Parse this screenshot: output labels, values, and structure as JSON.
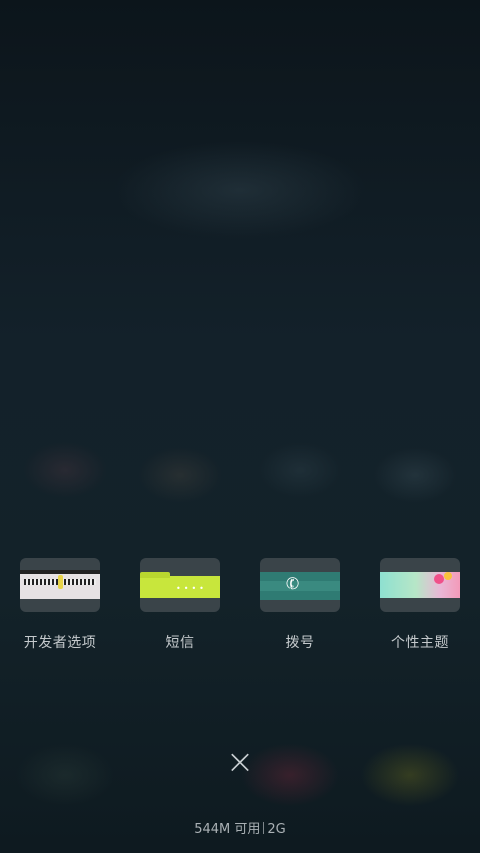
{
  "recent_apps": [
    {
      "label": "开发者选项",
      "thumb": "developer-options-preview"
    },
    {
      "label": "短信",
      "thumb": "sms-preview"
    },
    {
      "label": "拨号",
      "thumb": "dialer-preview"
    },
    {
      "label": "个性主题",
      "thumb": "themes-preview"
    }
  ],
  "close_icon": "×",
  "memory": {
    "available": "544M 可用",
    "total": "2G"
  }
}
